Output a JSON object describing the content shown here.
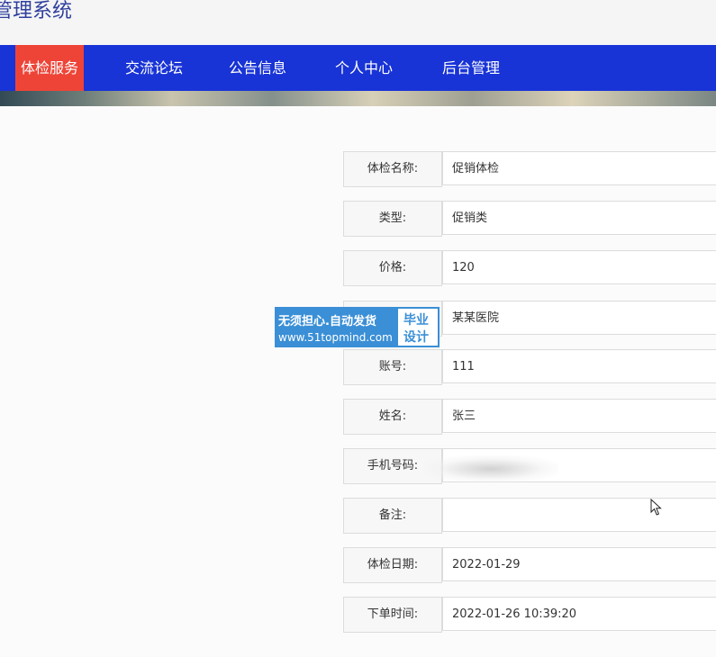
{
  "header": {
    "title": "管理系统"
  },
  "nav": {
    "items": [
      {
        "label": "体检服务"
      },
      {
        "label": "交流论坛"
      },
      {
        "label": "公告信息"
      },
      {
        "label": "个人中心"
      },
      {
        "label": "后台管理"
      }
    ]
  },
  "form": {
    "rows": [
      {
        "label": "体检名称:",
        "value": "促销体检"
      },
      {
        "label": "类型:",
        "value": "促销类"
      },
      {
        "label": "价格:",
        "value": "120"
      },
      {
        "label": "",
        "value": "某某医院"
      },
      {
        "label": "账号:",
        "value": "111"
      },
      {
        "label": "姓名:",
        "value": "张三"
      },
      {
        "label": "手机号码:",
        "value": ""
      },
      {
        "label": "备注:",
        "value": ""
      },
      {
        "label": "体检日期:",
        "value": "2022-01-29"
      },
      {
        "label": "下单时间:",
        "value": "2022-01-26 10:39:20"
      }
    ]
  },
  "watermark": {
    "line1": "无须担心.自动发货",
    "line2": "www.51topmind.com",
    "badge1": "毕业",
    "badge2": "设计"
  },
  "icons": {
    "cursor": "mouse-pointer-icon"
  },
  "colors": {
    "nav_bg": "#1833d6",
    "nav_active": "#ee4437",
    "title": "#2f3f9e",
    "watermark": "#3a8fd6"
  }
}
